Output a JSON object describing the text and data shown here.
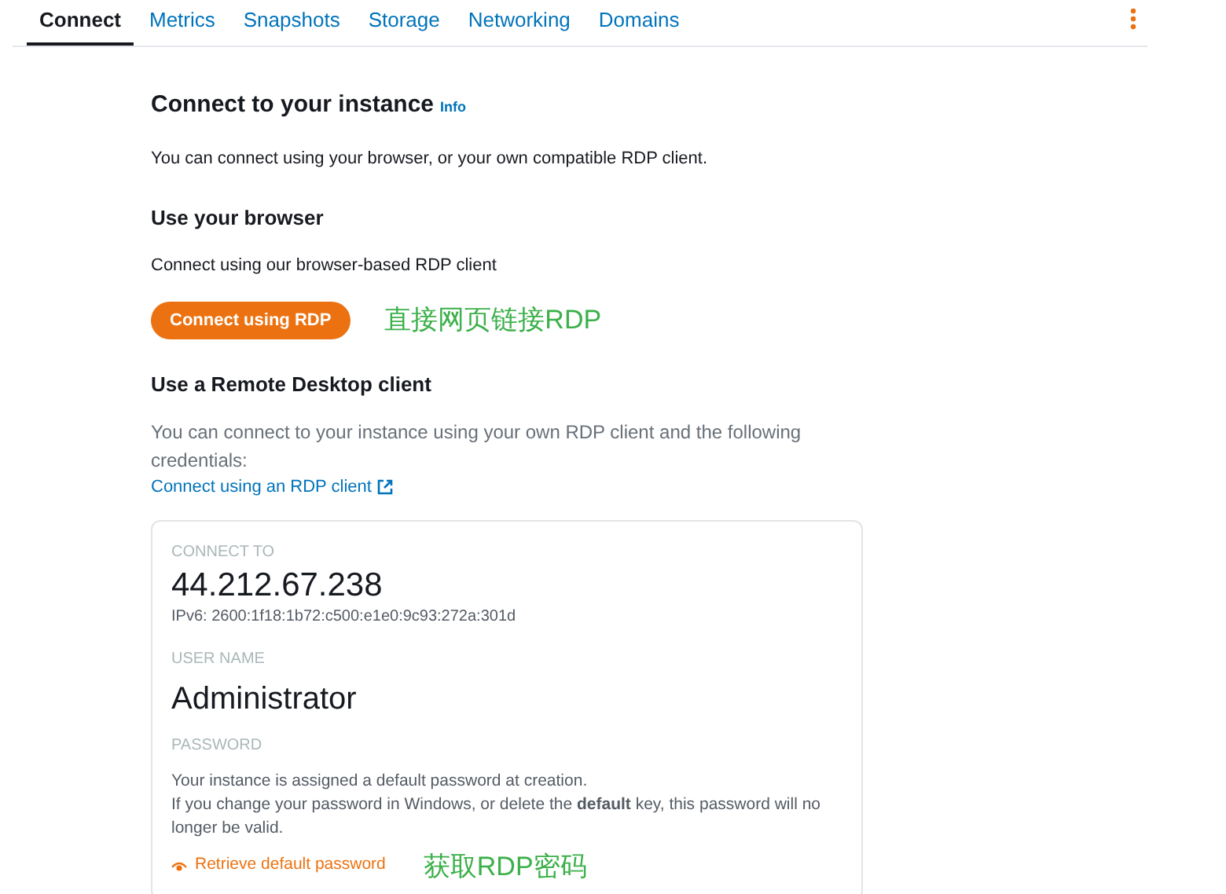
{
  "tabs": [
    {
      "label": "Connect",
      "selected": true
    },
    {
      "label": "Metrics",
      "selected": false
    },
    {
      "label": "Snapshots",
      "selected": false
    },
    {
      "label": "Storage",
      "selected": false
    },
    {
      "label": "Networking",
      "selected": false
    },
    {
      "label": "Domains",
      "selected": false
    }
  ],
  "title": "Connect to your instance",
  "info_link": "Info",
  "intro": "You can connect using your browser, or your own compatible RDP client.",
  "browser_section": {
    "heading": "Use your browser",
    "text": "Connect using our browser-based RDP client",
    "button": "Connect using RDP",
    "annotation": "直接网页链接RDP"
  },
  "client_section": {
    "heading": "Use a Remote Desktop client",
    "text": "You can connect to your instance using your own RDP client and the following credentials:",
    "link": "Connect using an RDP client"
  },
  "credentials": {
    "connect_to_label": "CONNECT TO",
    "ip": "44.212.67.238",
    "ipv6": "IPv6: 2600:1f18:1b72:c500:e1e0:9c93:272a:301d",
    "user_label": "USER NAME",
    "user": "Administrator",
    "password_label": "PASSWORD",
    "password_note_1": "Your instance is assigned a default password at creation.",
    "password_note_2": "If you change your password in Windows, or delete the **default** key, this password will no longer be valid.",
    "retrieve_link": "Retrieve default password",
    "annotation": "获取RDP密码"
  }
}
